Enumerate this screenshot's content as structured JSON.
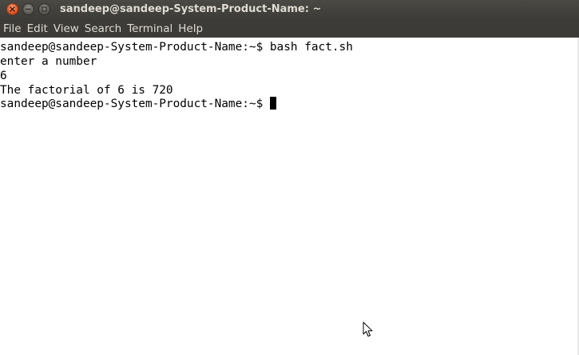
{
  "window": {
    "title": "sandeep@sandeep-System-Product-Name: ~"
  },
  "menubar": {
    "items": [
      "File",
      "Edit",
      "View",
      "Search",
      "Terminal",
      "Help"
    ]
  },
  "terminal": {
    "lines": [
      "sandeep@sandeep-System-Product-Name:~$ bash fact.sh",
      "enter a number",
      "6",
      "The factorial of 6 is 720",
      "sandeep@sandeep-System-Product-Name:~$ "
    ]
  },
  "icons": {
    "close": "close-icon",
    "minimize": "minimize-icon",
    "maximize": "maximize-icon",
    "pointer": "mouse-pointer-icon"
  },
  "colors": {
    "titlebar": "#3c3b37",
    "close_button": "#e05a2b",
    "terminal_bg": "#ffffff",
    "terminal_fg": "#000000"
  }
}
